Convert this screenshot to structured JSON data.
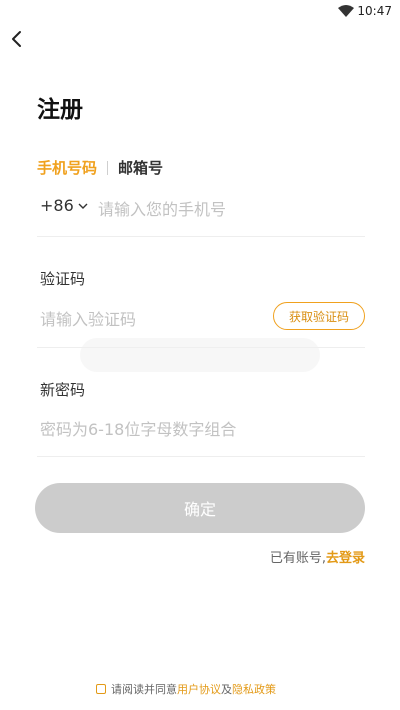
{
  "status_bar": {
    "time": "10:47",
    "icons": [
      "wifi-icon"
    ]
  },
  "header": {
    "back_icon": "chevron-left-icon"
  },
  "page": {
    "title": "注册"
  },
  "tabs": [
    {
      "label": "手机号码",
      "active": true
    },
    {
      "label": "邮箱号",
      "active": false
    }
  ],
  "phone": {
    "country_code": "+86",
    "placeholder": "请输入您的手机号",
    "value": ""
  },
  "code": {
    "label": "验证码",
    "placeholder": "请输入验证码",
    "value": "",
    "button_label": "获取验证码"
  },
  "password": {
    "label": "新密码",
    "placeholder": "密码为6-18位字母数字组合",
    "value": ""
  },
  "confirm_button": {
    "label": "确定",
    "enabled": false
  },
  "login_prompt": {
    "text": "已有账号,",
    "link": "去登录"
  },
  "agreement": {
    "checked": false,
    "prefix": "请阅读并同意",
    "user_agreement": "用户协议",
    "and": "及",
    "privacy_policy": "隐私政策"
  },
  "colors": {
    "accent": "#f0a11e",
    "button_disabled": "#cccccc",
    "placeholder": "#c2c2c2"
  }
}
